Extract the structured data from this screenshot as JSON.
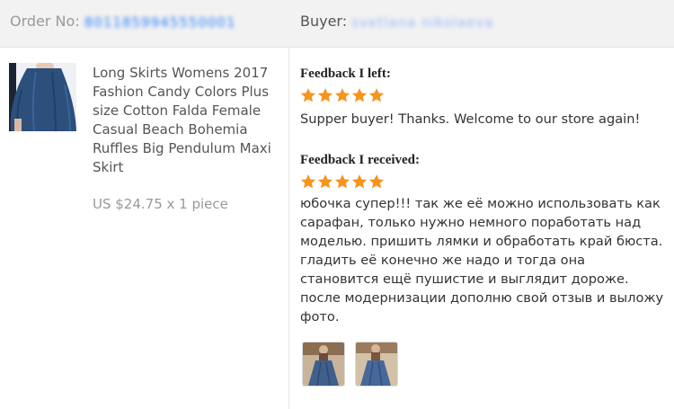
{
  "header": {
    "order_label": "Order No:",
    "order_number": "8011859945550001",
    "buyer_label": "Buyer:",
    "buyer_name": "svetlana nikolaeva"
  },
  "product": {
    "title": "Long Skirts Womens 2017 Fashion Candy Colors Plus size Cotton Falda Female Casual Beach Bohemia Ruffles Big Pendulum Maxi Skirt",
    "price_line": "US $24.75 x 1 piece",
    "image_icon": "skirt-photo"
  },
  "feedback_left": {
    "heading": "Feedback I left:",
    "stars": 5,
    "text": "Supper buyer! Thanks. Welcome to our store again!"
  },
  "feedback_received": {
    "heading": "Feedback I received:",
    "stars": 5,
    "text": "юбочка супер!!! так же её можно использовать как сарафан, только нужно немного поработать над моделью. пришить лямки и обработать край бюста. гладить её конечно же надо и тогда она становится ещё пушистие и выглядит дороже. после модернизации дополню свой отзыв и выложу фото.",
    "photos": [
      {
        "icon": "buyer-photo-icon"
      },
      {
        "icon": "buyer-photo-icon"
      }
    ]
  },
  "colors": {
    "star": "#f7941d",
    "header_bg": "#f2f2f2",
    "masked_text": "#2a7fff"
  }
}
